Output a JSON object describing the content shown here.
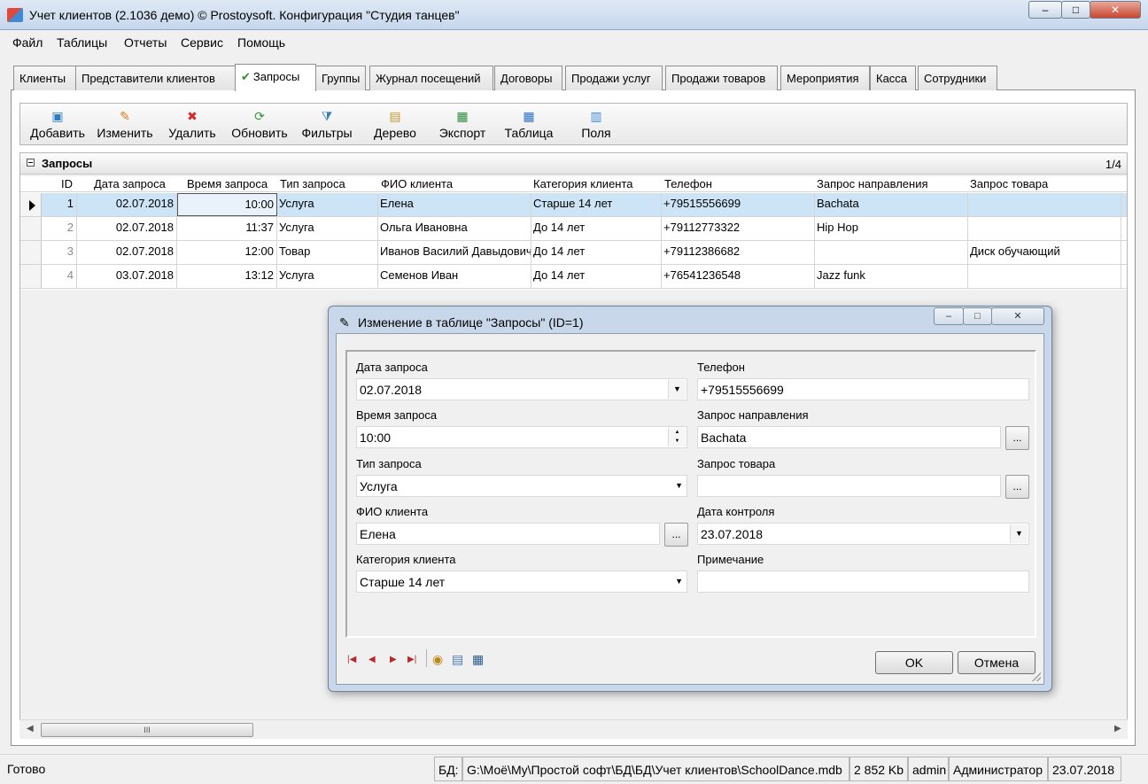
{
  "window": {
    "title": "Учет клиентов (2.1036 демо) © Prostoysoft. Конфигурация \"Студия танцев\"",
    "minimize_label": "–",
    "maximize_label": "□",
    "close_label": "✕"
  },
  "menu": [
    "Файл",
    "Таблицы",
    "Отчеты",
    "Сервис",
    "Помощь"
  ],
  "tabs": [
    {
      "label": "Клиенты",
      "active": false
    },
    {
      "label": "Представители клиентов",
      "active": false
    },
    {
      "label": "Запросы",
      "active": true
    },
    {
      "label": "Группы",
      "active": false
    },
    {
      "label": "Журнал посещений",
      "active": false
    },
    {
      "label": "Договоры",
      "active": false
    },
    {
      "label": "Продажи услуг",
      "active": false
    },
    {
      "label": "Продажи товаров",
      "active": false
    },
    {
      "label": "Мероприятия",
      "active": false
    },
    {
      "label": "Касса",
      "active": false
    },
    {
      "label": "Сотрудники",
      "active": false
    }
  ],
  "toolbar": {
    "buttons": [
      {
        "label": "Добавить",
        "icon": "add-document-icon",
        "glyph": "▣",
        "color": "#2a7fc4"
      },
      {
        "label": "Изменить",
        "icon": "pencil-icon",
        "glyph": "✎",
        "color": "#e07a12"
      },
      {
        "label": "Удалить",
        "icon": "delete-x-icon",
        "glyph": "✖",
        "color": "#d42a2a"
      },
      {
        "label": "Обновить",
        "icon": "refresh-icon",
        "glyph": "⟳",
        "color": "#2d9a3a"
      },
      {
        "label": "Фильтры",
        "icon": "filter-funnel-icon",
        "glyph": "⧩",
        "color": "#3a7fc4"
      },
      {
        "label": "Дерево",
        "icon": "tree-icon",
        "glyph": "▤",
        "color": "#c9962a"
      },
      {
        "label": "Экспорт",
        "icon": "export-excel-icon",
        "glyph": "▦",
        "color": "#2d8a3a"
      },
      {
        "label": "Таблица",
        "icon": "table-icon",
        "glyph": "▦",
        "color": "#2a6fc4"
      },
      {
        "label": "Поля",
        "icon": "fields-icon",
        "glyph": "▥",
        "color": "#3a8ad4"
      }
    ]
  },
  "grid": {
    "panel_title": "Запросы",
    "record_counter": "1/4",
    "columns": [
      "ID",
      "Дата запроса",
      "Время запроса",
      "Тип запроса",
      "ФИО клиента",
      "Категория клиента",
      "Телефон",
      "Запрос направления",
      "Запрос товара"
    ],
    "rows": [
      {
        "id": "1",
        "date": "02.07.2018",
        "time": "10:00",
        "type": "Услуга",
        "name": "Елена",
        "category": "Старше 14 лет",
        "phone": "+79515556699",
        "direction": "Bachata",
        "product": ""
      },
      {
        "id": "2",
        "date": "02.07.2018",
        "time": "11:37",
        "type": "Услуга",
        "name": "Ольга Ивановна",
        "category": "До 14 лет",
        "phone": "+79112773322",
        "direction": "Hip Hop",
        "product": ""
      },
      {
        "id": "3",
        "date": "02.07.2018",
        "time": "12:00",
        "type": "Товар",
        "name": "Иванов Василий Давыдович",
        "category": "До 14 лет",
        "phone": "+79112386682",
        "direction": "",
        "product": "Диск обучающий"
      },
      {
        "id": "4",
        "date": "03.07.2018",
        "time": "13:12",
        "type": "Услуга",
        "name": "Семенов Иван",
        "category": "До 14 лет",
        "phone": "+76541236548",
        "direction": "Jazz funk",
        "product": ""
      }
    ]
  },
  "scrollbar": {
    "thumb_grip": "III"
  },
  "dialog": {
    "title": "Изменение в таблице \"Запросы\" (ID=1)",
    "fields": {
      "request_date": {
        "label": "Дата запроса",
        "value": "02.07.2018"
      },
      "request_time": {
        "label": "Время запроса",
        "value": "10:00"
      },
      "request_type": {
        "label": "Тип запроса",
        "value": "Услуга"
      },
      "client_name": {
        "label": "ФИО клиента",
        "value": "Елена"
      },
      "client_category": {
        "label": "Категория клиента",
        "value": "Старше 14 лет"
      },
      "phone": {
        "label": "Телефон",
        "value": "+79515556699"
      },
      "direction": {
        "label": "Запрос направления",
        "value": "Bachata"
      },
      "product": {
        "label": "Запрос товара",
        "value": ""
      },
      "control_date": {
        "label": "Дата контроля",
        "value": "23.07.2018"
      },
      "note": {
        "label": "Примечание",
        "value": ""
      }
    },
    "ellipsis_label": "...",
    "ok_label": "OK",
    "cancel_label": "Отмена"
  },
  "statusbar": {
    "state": "Готово",
    "db_label": "БД:",
    "db_path": "G:\\Моё\\My\\Простой софт\\БД\\БД\\Учет клиентов\\SchoolDance.mdb",
    "db_size": "2 852 Kb",
    "user": "admin",
    "role": "Администратор",
    "date": "23.07.2018"
  }
}
